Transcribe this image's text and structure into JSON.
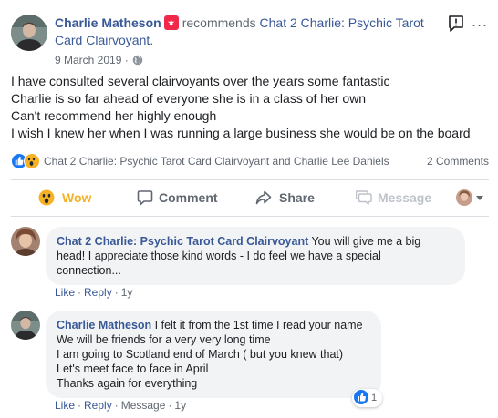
{
  "post": {
    "author": "Charlie Matheson",
    "verb": "recommends",
    "page_name": "Chat 2 Charlie: Psychic Tarot Card Clairvoyant.",
    "date": "9 March 2019",
    "date_sep": "·",
    "body": [
      "I have consulted several clairvoyants over the years some fantastic",
      "Charlie is so far ahead of everyone she is in a class of her own",
      "Can't recommend her highly enough",
      "I wish I knew her when I was running a large business she would be on the board"
    ],
    "more_icon": "..."
  },
  "reactions": {
    "names": "Chat 2 Charlie: Psychic Tarot Card Clairvoyant and Charlie Lee Daniels",
    "comments_count": "2 Comments",
    "icons": [
      "like-icon",
      "wow-icon"
    ]
  },
  "actions": {
    "wow": "Wow",
    "comment": "Comment",
    "share": "Share",
    "message": "Message"
  },
  "comments": [
    {
      "author": "Chat 2 Charlie: Psychic Tarot Card Clairvoyant",
      "lines": [
        " You will give me a big",
        "head! I appreciate those kind words - I do feel we have a special",
        "connection..."
      ],
      "actions": [
        "Like",
        "Reply"
      ],
      "sep": "·",
      "time": "1y"
    },
    {
      "author": "Charlie Matheson",
      "lines": [
        " I felt it from the 1st time I read your name",
        "We will be friends for a very very long time",
        "I am going to Scotland end of March ( but you knew that)",
        "Let's meet face to face in April",
        "Thanks again for everything"
      ],
      "actions": [
        "Like",
        "Reply",
        "Message"
      ],
      "sep": "·",
      "time": "1y",
      "reaction_count": "1"
    }
  ],
  "colors": {
    "link": "#385898",
    "muted": "#606770",
    "like_blue": "#1877f2",
    "wow_yellow": "#f7b125",
    "recommend_red": "#f0284a",
    "bubble_bg": "#f2f3f5"
  }
}
